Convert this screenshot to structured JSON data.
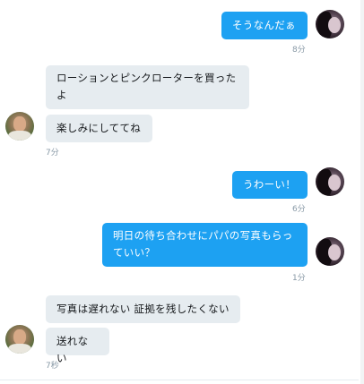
{
  "messages": [
    {
      "text": "そうなんだぁ",
      "time": "8分"
    },
    {
      "text": "ローションとピンクローターを買ったよ"
    },
    {
      "text": "楽しみにしててね",
      "time": "7分"
    },
    {
      "text": "うわーい！",
      "time": "6分"
    },
    {
      "text": "明日の待ち合わせにパパの写真もらっていい？",
      "time": "1分"
    },
    {
      "text": "写真は遅れない 証拠を残したくない"
    },
    {
      "text": "送れない",
      "time": "7秒"
    }
  ]
}
